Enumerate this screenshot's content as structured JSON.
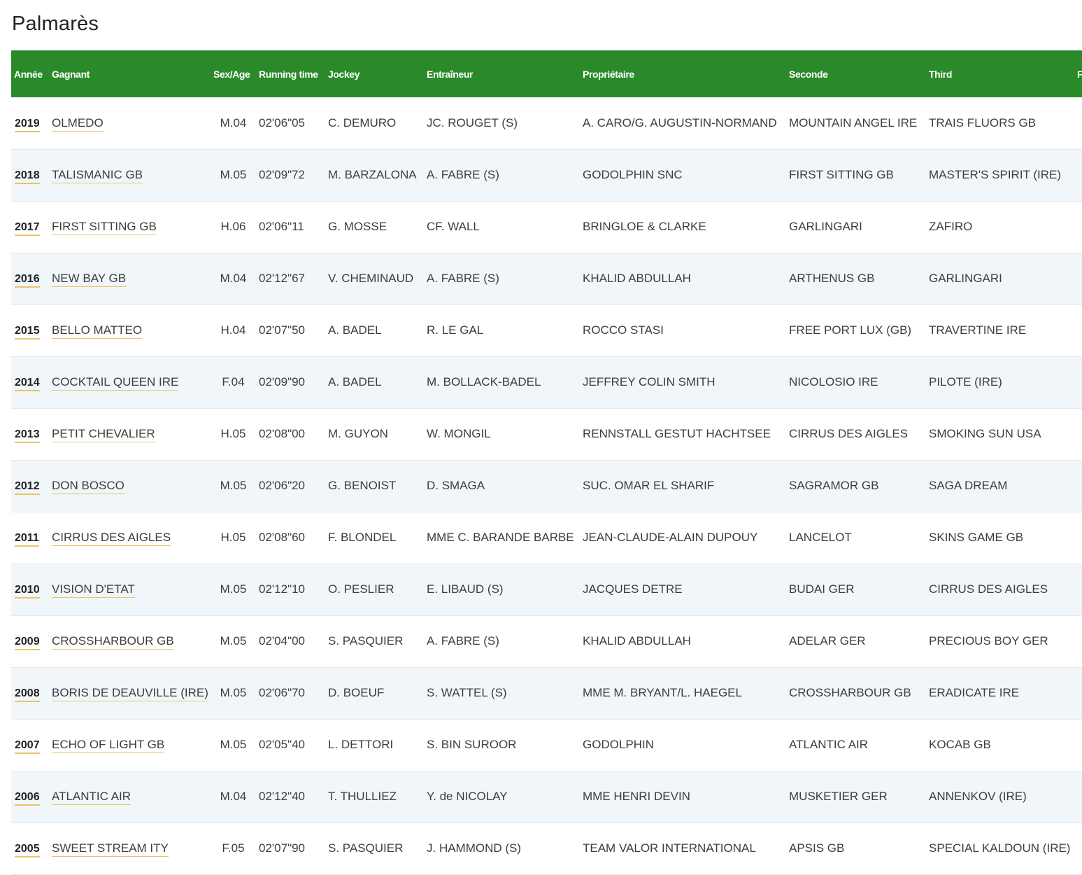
{
  "page": {
    "title": "Palmarès"
  },
  "colors": {
    "header_bg": "#2a8a2a",
    "row_alt_bg": "#f1f6fb",
    "link_underline": "#e8c46b"
  },
  "table": {
    "headers": [
      "Année",
      "Gagnant",
      "Sex/Age",
      "Running time",
      "Jockey",
      "Entraîneur",
      "Propriétaire",
      "Seconde",
      "Third",
      "F"
    ],
    "rows": [
      {
        "year": "2019",
        "winner": "OLMEDO",
        "sex_age": "M.04",
        "time": "02'06\"05",
        "jockey": "C. DEMURO",
        "trainer": "JC. ROUGET (S)",
        "owner": "A. CARO/G. AUGUSTIN-NORMAND",
        "second": "MOUNTAIN ANGEL IRE",
        "third": "TRAIS FLUORS GB"
      },
      {
        "year": "2018",
        "winner": "TALISMANIC GB",
        "sex_age": "M.05",
        "time": "02'09\"72",
        "jockey": "M. BARZALONA",
        "trainer": "A. FABRE (S)",
        "owner": "GODOLPHIN SNC",
        "second": "FIRST SITTING GB",
        "third": "MASTER'S SPIRIT (IRE)"
      },
      {
        "year": "2017",
        "winner": "FIRST SITTING GB",
        "sex_age": "H.06",
        "time": "02'06\"11",
        "jockey": "G. MOSSE",
        "trainer": "CF. WALL",
        "owner": "BRINGLOE & CLARKE",
        "second": "GARLINGARI",
        "third": "ZAFIRO"
      },
      {
        "year": "2016",
        "winner": "NEW BAY GB",
        "sex_age": "M.04",
        "time": "02'12\"67",
        "jockey": "V. CHEMINAUD",
        "trainer": "A. FABRE (S)",
        "owner": "KHALID ABDULLAH",
        "second": "ARTHENUS GB",
        "third": "GARLINGARI"
      },
      {
        "year": "2015",
        "winner": "BELLO MATTEO",
        "sex_age": "H.04",
        "time": "02'07\"50",
        "jockey": "A. BADEL",
        "trainer": "R. LE GAL",
        "owner": "ROCCO STASI",
        "second": "FREE PORT LUX (GB)",
        "third": "TRAVERTINE IRE"
      },
      {
        "year": "2014",
        "winner": "COCKTAIL QUEEN IRE",
        "sex_age": "F.04",
        "time": "02'09\"90",
        "jockey": "A. BADEL",
        "trainer": "M. BOLLACK-BADEL",
        "owner": "JEFFREY COLIN SMITH",
        "second": "NICOLOSIO IRE",
        "third": "PILOTE (IRE)"
      },
      {
        "year": "2013",
        "winner": "PETIT CHEVALIER",
        "sex_age": "H.05",
        "time": "02'08\"00",
        "jockey": "M. GUYON",
        "trainer": "W. MONGIL",
        "owner": "RENNSTALL GESTUT HACHTSEE",
        "second": "CIRRUS DES AIGLES",
        "third": "SMOKING SUN USA"
      },
      {
        "year": "2012",
        "winner": "DON BOSCO",
        "sex_age": "M.05",
        "time": "02'06\"20",
        "jockey": "G. BENOIST",
        "trainer": "D. SMAGA",
        "owner": "SUC. OMAR EL SHARIF",
        "second": "SAGRAMOR GB",
        "third": "SAGA DREAM"
      },
      {
        "year": "2011",
        "winner": "CIRRUS DES AIGLES",
        "sex_age": "H.05",
        "time": "02'08\"60",
        "jockey": "F. BLONDEL",
        "trainer": "MME C. BARANDE BARBE",
        "owner": "JEAN-CLAUDE-ALAIN DUPOUY",
        "second": "LANCELOT",
        "third": "SKINS GAME GB"
      },
      {
        "year": "2010",
        "winner": "VISION D'ETAT",
        "sex_age": "M.05",
        "time": "02'12\"10",
        "jockey": "O. PESLIER",
        "trainer": "E. LIBAUD (S)",
        "owner": "JACQUES DETRE",
        "second": "BUDAI GER",
        "third": "CIRRUS DES AIGLES"
      },
      {
        "year": "2009",
        "winner": "CROSSHARBOUR GB",
        "sex_age": "M.05",
        "time": "02'04\"00",
        "jockey": "S. PASQUIER",
        "trainer": "A. FABRE (S)",
        "owner": "KHALID ABDULLAH",
        "second": "ADELAR GER",
        "third": "PRECIOUS BOY GER"
      },
      {
        "year": "2008",
        "winner": "BORIS DE DEAUVILLE (IRE)",
        "sex_age": "M.05",
        "time": "02'06\"70",
        "jockey": "D. BOEUF",
        "trainer": "S. WATTEL (S)",
        "owner": "MME M. BRYANT/L. HAEGEL",
        "second": "CROSSHARBOUR GB",
        "third": "ERADICATE IRE"
      },
      {
        "year": "2007",
        "winner": "ECHO OF LIGHT GB",
        "sex_age": "M.05",
        "time": "02'05\"40",
        "jockey": "L. DETTORI",
        "trainer": "S. BIN SUROOR",
        "owner": "GODOLPHIN",
        "second": "ATLANTIC AIR",
        "third": "KOCAB GB"
      },
      {
        "year": "2006",
        "winner": "ATLANTIC AIR",
        "sex_age": "M.04",
        "time": "02'12\"40",
        "jockey": "T. THULLIEZ",
        "trainer": "Y. de NICOLAY",
        "owner": "MME HENRI DEVIN",
        "second": "MUSKETIER GER",
        "third": "ANNENKOV (IRE)"
      },
      {
        "year": "2005",
        "winner": "SWEET STREAM ITY",
        "sex_age": "F.05",
        "time": "02'07\"90",
        "jockey": "S. PASQUIER",
        "trainer": "J. HAMMOND (S)",
        "owner": "TEAM VALOR INTERNATIONAL",
        "second": "APSIS GB",
        "third": "SPECIAL KALDOUN (IRE)"
      }
    ]
  }
}
